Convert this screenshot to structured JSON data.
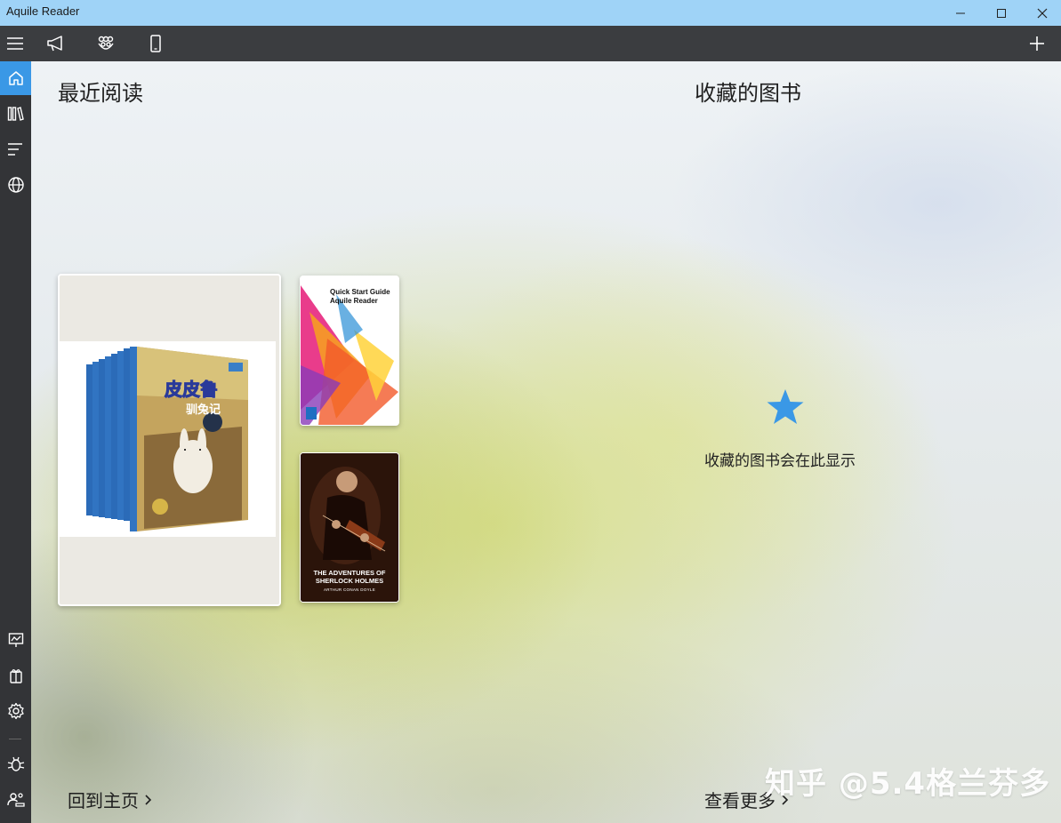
{
  "window": {
    "title": "Aquile Reader"
  },
  "toolbar": {
    "icons": [
      "hamburger-menu-icon",
      "megaphone-icon",
      "community-icon",
      "phone-icon",
      "add-icon"
    ]
  },
  "sidebar": {
    "items": [
      "home-icon",
      "library-icon",
      "list-icon",
      "globe-icon",
      "presentation-icon",
      "gift-icon",
      "settings-icon",
      "bug-icon",
      "account-icon"
    ]
  },
  "recent": {
    "title": "最近阅读",
    "books": [
      {
        "cover_title": "皮皮鲁",
        "cover_subtitle": "驯兔记"
      },
      {
        "cover_title": "Quick Start Guide",
        "cover_subtitle": "Aquile Reader"
      },
      {
        "cover_title": "THE ADVENTURES OF SHERLOCK HOLMES",
        "cover_subtitle": "ARTHUR CONAN DOYLE"
      }
    ],
    "back_link": "回到主页"
  },
  "favorites": {
    "title": "收藏的图书",
    "empty_text": "收藏的图书会在此显示",
    "more_link": "查看更多"
  },
  "watermark": "知乎 @5.4格兰芬多",
  "colors": {
    "accent": "#3a98e6",
    "titlebar": "#9fd3f7",
    "toolbar": "#3b3d40",
    "sidebar": "#333437",
    "star": "#3a98e6"
  }
}
